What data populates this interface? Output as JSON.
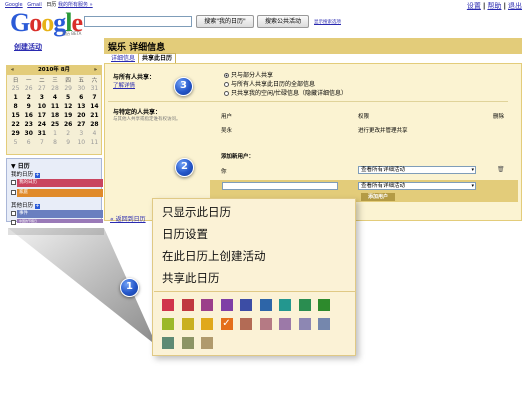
{
  "topbar": {
    "left_links": [
      "Google",
      "Gmail",
      "日历",
      "我的所有服务 »"
    ],
    "right_links": [
      "设置",
      "帮助",
      "退出"
    ]
  },
  "logo": {
    "text": "Google",
    "sub": "日历 BETA"
  },
  "search": {
    "my_cal_button": "搜索\"我的日历\"",
    "public_button": "搜索公共活动",
    "options_link": "显示搜索选项"
  },
  "sidebar": {
    "create_event": "创建活动",
    "minical": {
      "title": "2010年 8月",
      "prev": "«",
      "next": "»",
      "dow": [
        "日",
        "一",
        "二",
        "三",
        "四",
        "五",
        "六"
      ],
      "weeks": [
        [
          "25",
          "26",
          "27",
          "28",
          "29",
          "30",
          "31"
        ],
        [
          "1",
          "2",
          "3",
          "4",
          "5",
          "6",
          "7"
        ],
        [
          "8",
          "9",
          "10",
          "11",
          "12",
          "13",
          "14"
        ],
        [
          "15",
          "16",
          "17",
          "18",
          "19",
          "20",
          "21"
        ],
        [
          "22",
          "23",
          "24",
          "25",
          "26",
          "27",
          "28"
        ],
        [
          "29",
          "30",
          "31",
          "1",
          "2",
          "3",
          "4"
        ],
        [
          "5",
          "6",
          "7",
          "8",
          "9",
          "10",
          "11"
        ]
      ]
    },
    "calendars": {
      "title": "▼ 日历",
      "my_label": "我的日历",
      "my_items": [
        "我的日历",
        "家庭"
      ],
      "other_label": "其他日历",
      "other_items": [
        "事件",
        "中国的节假日"
      ]
    },
    "back_link": "« 返回到日历"
  },
  "header": {
    "title": "娱乐 详细信息",
    "tabs": [
      "详细信息",
      "共享此日历"
    ]
  },
  "share_all": {
    "label": "与所有人共享：",
    "learn_more": "了解详情",
    "options": [
      "只与部分人共享",
      "与所有人共享此日历的全部信息",
      "只共享我的空闲/忙碌信息（隐藏详细信息）"
    ]
  },
  "share_specific": {
    "label": "与特定的人共享：",
    "hint": "与其他人共享或指定谁有权访问。",
    "col_user": "用户",
    "col_perm": "权限",
    "col_delete": "删除",
    "rows": [
      {
        "user": "吴永",
        "perm": "进行更改并管理共享"
      }
    ],
    "add_label": "添加新用户：",
    "you": "你",
    "perm_select": "查看所有详细活动",
    "perm_select2": "查看所有详细活动",
    "add_button": "添加用户"
  },
  "context_menu": {
    "items": [
      "只显示此日历",
      "日历设置",
      "在此日历上创建活动",
      "共享此日历"
    ],
    "colors": [
      "#d0344b",
      "#c0383f",
      "#9b3f8a",
      "#7f3fa6",
      "#3c4da5",
      "#2d65a8",
      "#23978f",
      "#2a8d50",
      "#2d8a2c",
      "#9cb82a",
      "#c9b020",
      "#e0a81c",
      "#e46f1c",
      "#b36b55",
      "#b57a84",
      "#9c79a8",
      "#8d87b3",
      "#7587ad",
      "#5e8a74",
      "#8c9465",
      "#b09a6d"
    ],
    "selected_index": 12,
    "selected_mark": "✓"
  },
  "badges": [
    "1",
    "2",
    "3"
  ]
}
